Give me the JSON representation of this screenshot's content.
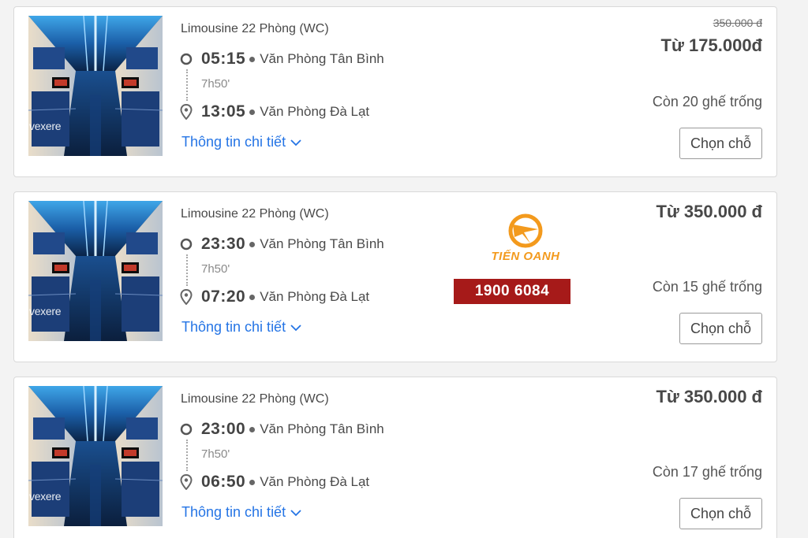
{
  "trips": [
    {
      "bus_name": "Limousine 22 Phòng (WC)",
      "depart_time": "05:15",
      "depart_station": "Văn Phòng Tân Bình",
      "duration": "7h50'",
      "arrive_time": "13:05",
      "arrive_station": "Văn Phòng Đà Lạt",
      "details_label": "Thông tin chi tiết",
      "old_price": "350.000 đ",
      "price": "Từ 175.000đ",
      "seats_left": "Còn 20 ghế trống",
      "select_label": "Chọn chỗ",
      "image_watermark": "vexere"
    },
    {
      "bus_name": "Limousine 22 Phòng (WC)",
      "depart_time": "23:30",
      "depart_station": "Văn Phòng Tân Bình",
      "duration": "7h50'",
      "arrive_time": "07:20",
      "arrive_station": "Văn Phòng Đà Lạt",
      "details_label": "Thông tin chi tiết",
      "price": "Từ 350.000 đ",
      "seats_left": "Còn 15 ghế trống",
      "select_label": "Chọn chỗ",
      "image_watermark": "vexere"
    },
    {
      "bus_name": "Limousine 22 Phòng (WC)",
      "depart_time": "23:00",
      "depart_station": "Văn Phòng Tân Bình",
      "duration": "7h50'",
      "arrive_time": "06:50",
      "arrive_station": "Văn Phòng Đà Lạt",
      "details_label": "Thông tin chi tiết",
      "price": "Từ 350.000 đ",
      "seats_left": "Còn 17 ghế trống",
      "select_label": "Chọn chỗ",
      "image_watermark": "vexere"
    }
  ],
  "overlay": {
    "brand_name": "TIẾN OANH",
    "hotline": "1900 6084"
  },
  "colors": {
    "link": "#2474e5",
    "hotline_bg": "#a61a19",
    "brand_orange": "#f39a1d"
  },
  "icons": {
    "depart": "circle-outline-icon",
    "arrive": "location-pin-icon",
    "details": "chevron-down-icon"
  }
}
